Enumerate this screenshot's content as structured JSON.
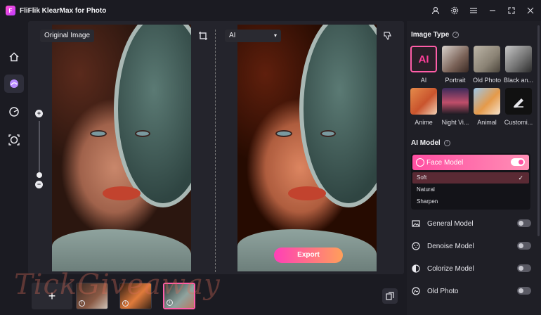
{
  "app": {
    "title": "FliFlik KlearMax for Photo",
    "logo_text": "F"
  },
  "canvas": {
    "original_label": "Original Image",
    "ai_select_value": "AI",
    "export_label": "Export"
  },
  "strip": {
    "add_label": "+"
  },
  "watermark": "TickGiveaway",
  "image_type": {
    "title": "Image Type",
    "items": [
      {
        "label": "AI",
        "glyph": "AI"
      },
      {
        "label": "Portrait"
      },
      {
        "label": "Old Photo"
      },
      {
        "label": "Black an..."
      },
      {
        "label": "Anime"
      },
      {
        "label": "Night Vi..."
      },
      {
        "label": "Animal"
      },
      {
        "label": "Customi..."
      }
    ]
  },
  "ai_model": {
    "title": "AI Model",
    "face_model": {
      "label": "Face Model",
      "enabled": true
    },
    "options": [
      {
        "label": "Soft",
        "selected": true,
        "check": "✓"
      },
      {
        "label": "Natural",
        "selected": false
      },
      {
        "label": "Sharpen",
        "selected": false
      }
    ],
    "models": [
      {
        "label": "General Model",
        "enabled": false,
        "icon": "image-icon"
      },
      {
        "label": "Denoise Model",
        "enabled": false,
        "icon": "denoise-icon"
      },
      {
        "label": "Colorize Model",
        "enabled": false,
        "icon": "colorize-icon"
      },
      {
        "label": "Old Photo",
        "enabled": false,
        "icon": "old-photo-icon"
      }
    ]
  },
  "colors": {
    "accent": "#ff4fa2",
    "export_start": "#ff3fb7",
    "export_end": "#ff9f5a",
    "background": "#1b1b22"
  }
}
